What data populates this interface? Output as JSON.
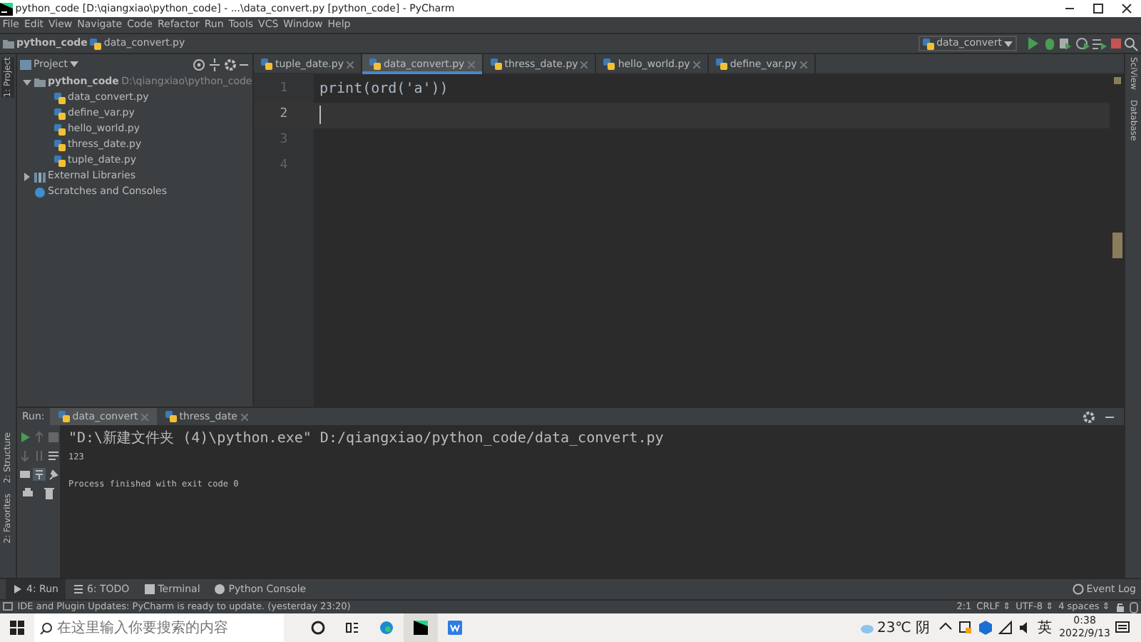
{
  "window": {
    "title": "python_code [D:\\qiangxiao\\python_code] - ...\\data_convert.py [python_code] - PyCharm"
  },
  "menu": [
    "File",
    "Edit",
    "View",
    "Navigate",
    "Code",
    "Refactor",
    "Run",
    "Tools",
    "VCS",
    "Window",
    "Help"
  ],
  "breadcrumb": [
    "python_code",
    "data_convert.py"
  ],
  "run_config": "data_convert",
  "left_stripe": [
    "1: Project",
    "2: Structure",
    "2: Favorites"
  ],
  "right_stripe": [
    "SciView",
    "Database"
  ],
  "project_panel": {
    "title": "Project",
    "tree": [
      {
        "label": "python_code",
        "path": "D:\\qiangxiao\\python_code",
        "kind": "folder",
        "expanded": true,
        "children": [
          {
            "label": "data_convert.py",
            "kind": "file"
          },
          {
            "label": "define_var.py",
            "kind": "file"
          },
          {
            "label": "hello_world.py",
            "kind": "file"
          },
          {
            "label": "thress_date.py",
            "kind": "file"
          },
          {
            "label": "tuple_date.py",
            "kind": "file"
          }
        ]
      },
      {
        "label": "External Libraries",
        "kind": "library",
        "expanded": false
      },
      {
        "label": "Scratches and Consoles",
        "kind": "scratch"
      }
    ]
  },
  "editor_tabs": [
    {
      "label": "tuple_date.py",
      "selected": false
    },
    {
      "label": "data_convert.py",
      "selected": true
    },
    {
      "label": "thress_date.py",
      "selected": false
    },
    {
      "label": "hello_world.py",
      "selected": false
    },
    {
      "label": "define_var.py",
      "selected": false
    }
  ],
  "editor": {
    "lines": [
      {
        "number": "1",
        "code": "print(ord('a'))",
        "current": false
      },
      {
        "number": "2",
        "current": true
      },
      {
        "number": "3",
        "current": false
      },
      {
        "number": "4",
        "current": false
      }
    ]
  },
  "run_panel": {
    "label": "Run:",
    "tabs": [
      {
        "label": "data_convert",
        "selected": true
      },
      {
        "label": "thress_date",
        "selected": false
      }
    ],
    "output": [
      {
        "text": "\"D:\\新建文件夹 (4)\\python.exe\" D:/qiangxiao/python_code/data_convert.py",
        "spaced": false
      },
      {
        "text": "123",
        "spaced": false
      },
      {
        "text": "Process finished with exit code 0",
        "spaced": true
      }
    ]
  },
  "tool_tabs": [
    {
      "label": "4: Run",
      "selected": true
    },
    {
      "label": "6: TODO",
      "selected": false
    },
    {
      "label": "Terminal",
      "selected": false
    },
    {
      "label": "Python Console",
      "selected": false
    }
  ],
  "event_log": "Event Log",
  "status_bar": {
    "message": "IDE and Plugin Updates: PyCharm is ready to update. (yesterday 23:20)",
    "items": [
      "2:1",
      "CRLF ⇕",
      "UTF-8 ⇕",
      "4 spaces ⇕"
    ]
  },
  "taskbar": {
    "search_placeholder": "在这里输入你要搜索的内容",
    "weather": "23℃ 阴",
    "ime": "英",
    "time": "0:38",
    "date": "2022/9/13"
  }
}
